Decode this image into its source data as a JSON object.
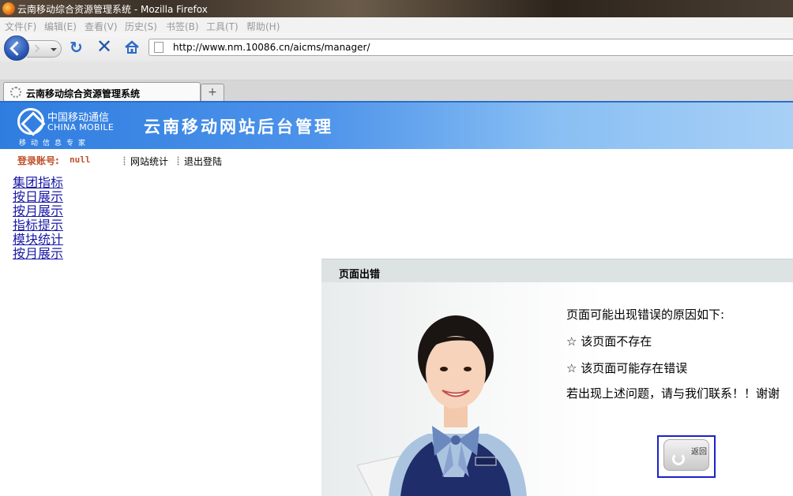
{
  "window": {
    "title": "云南移动综合资源管理系统 - Mozilla Firefox"
  },
  "menu": [
    "文件(F)",
    "编辑(E)",
    "查看(V)",
    "历史(S)",
    "书签(B)",
    "工具(T)",
    "帮助(H)"
  ],
  "address": {
    "url": "http://www.nm.10086.cn/aicms/manager/"
  },
  "tabs": [
    {
      "title": "云南移动综合资源管理系统"
    }
  ],
  "newtab_symbol": "+",
  "header": {
    "logo_cn": "中国移动通信",
    "logo_en": "CHINA MOBILE",
    "logo_sub": "移动信息专家",
    "title": "云南移动网站后台管理"
  },
  "login": {
    "label": "登录账号:",
    "value": "null"
  },
  "topnav": [
    "网站统计",
    "退出登陆"
  ],
  "sidebar_links": [
    "集团指标",
    "按日展示",
    "按月展示",
    "指标提示",
    "模块统计",
    "按月展示"
  ],
  "error": {
    "heading": "页面出错",
    "intro": "页面可能出现错误的原因如下:",
    "reason1": "☆ 该页面不存在",
    "reason2": "☆ 该页面可能存在错误",
    "contact": "若出现上述问题，请与我们联系！！谢谢",
    "return_label": "返回"
  },
  "colors": {
    "header_blue": "#2f7de0",
    "login_red": "#c0502a",
    "link_blue": "#1a1aa6"
  }
}
